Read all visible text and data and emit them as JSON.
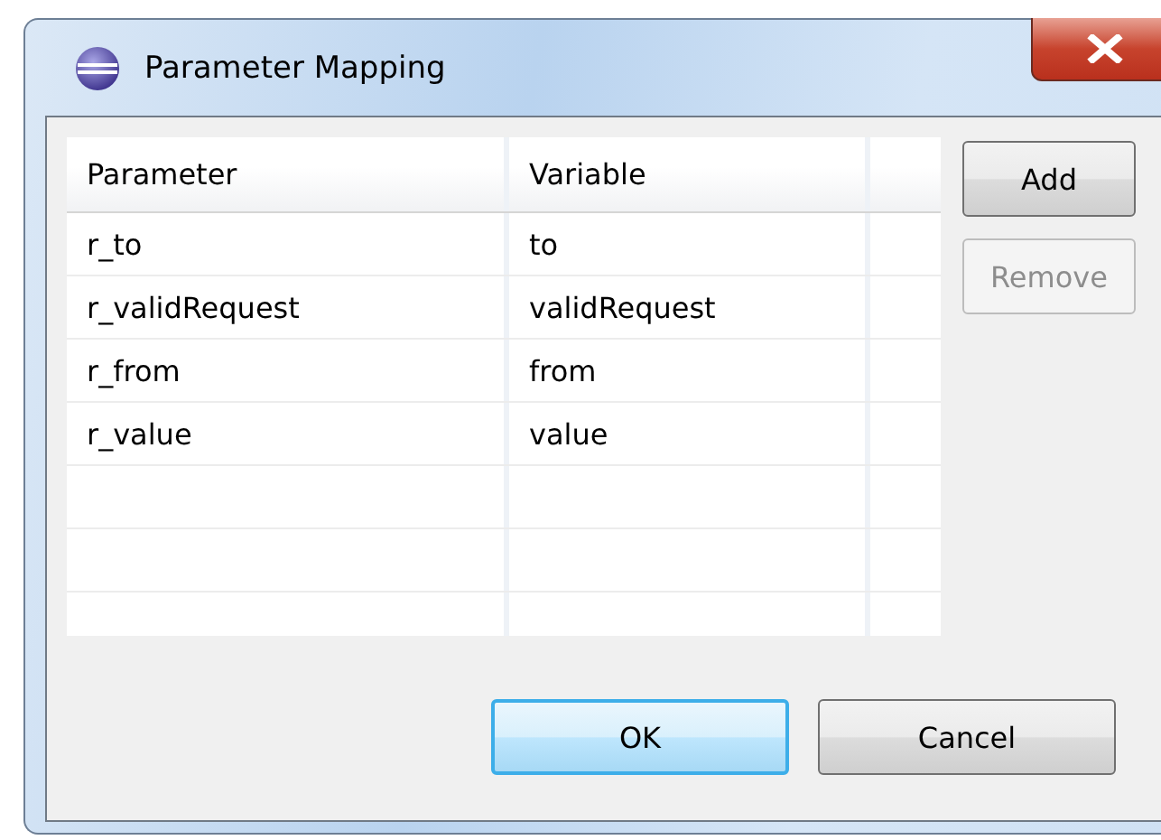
{
  "window": {
    "title": "Parameter Mapping"
  },
  "table": {
    "columns": [
      "Parameter",
      "Variable"
    ],
    "rows": [
      {
        "cells": [
          "r_to",
          "to"
        ]
      },
      {
        "cells": [
          "r_validRequest",
          "validRequest"
        ]
      },
      {
        "cells": [
          "r_from",
          "from"
        ]
      },
      {
        "cells": [
          "r_value",
          "value"
        ]
      }
    ]
  },
  "side_buttons": [
    {
      "label": "Add",
      "disabled": false
    },
    {
      "label": "Remove",
      "disabled": true
    }
  ],
  "buttons": [
    {
      "label": "OK",
      "default": true
    },
    {
      "label": "Cancel",
      "default": false
    }
  ]
}
